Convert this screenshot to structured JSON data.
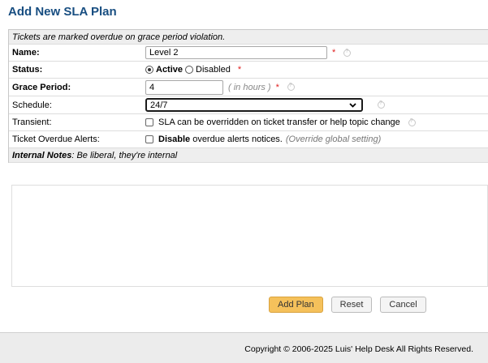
{
  "page": {
    "title": "Add New SLA Plan"
  },
  "form": {
    "notice": "Tickets are marked overdue on grace period violation.",
    "name": {
      "label": "Name:",
      "value": "Level 2",
      "required_mark": "*"
    },
    "status": {
      "label": "Status:",
      "options": [
        {
          "label": "Active",
          "checked": true
        },
        {
          "label": "Disabled",
          "checked": false
        }
      ],
      "required_mark": "*"
    },
    "grace_period": {
      "label": "Grace Period:",
      "value": "4",
      "hint": "( in hours )",
      "required_mark": "*"
    },
    "schedule": {
      "label": "Schedule:",
      "selected": "24/7"
    },
    "transient": {
      "label": "Transient:",
      "text": "SLA can be overridden on ticket transfer or help topic change",
      "checked": false
    },
    "overdue_alerts": {
      "label": "Ticket Overdue Alerts:",
      "strong": "Disable",
      "text": " overdue alerts notices.",
      "hint": "(Override global setting)",
      "checked": false
    },
    "internal_notes": {
      "label": "Internal Notes",
      "hint": ": Be liberal, they're internal",
      "value": ""
    }
  },
  "buttons": {
    "add": "Add Plan",
    "reset": "Reset",
    "cancel": "Cancel"
  },
  "footer": {
    "copyright": "Copyright © 2006-2025 Luis' Help Desk All Rights Reserved."
  },
  "colors": {
    "title": "#184e81",
    "required": "#e02020",
    "primary_button": "#f5c15b",
    "header_bg": "#eeeeee",
    "footer_bg": "#ececec"
  }
}
